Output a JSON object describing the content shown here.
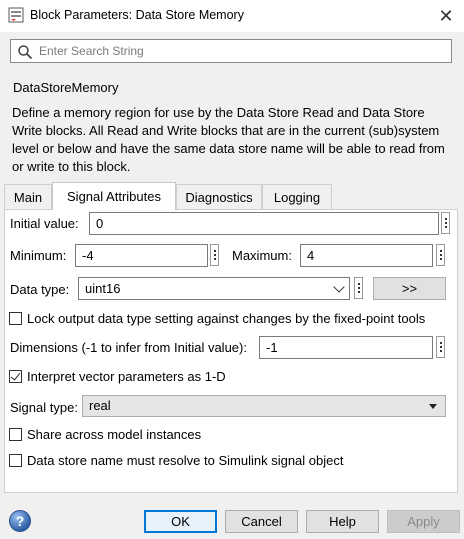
{
  "window": {
    "title": "Block Parameters: Data Store Memory",
    "close_glyph": "✕"
  },
  "search": {
    "placeholder": "Enter Search String",
    "value": ""
  },
  "block": {
    "name": "DataStoreMemory",
    "description": "Define a memory region for use by the Data Store Read and Data Store Write blocks. All Read and Write blocks that are in the current (sub)system level or below and have the same data store name will be able to read from or write to this block."
  },
  "tabs": [
    {
      "label": "Main",
      "active": false
    },
    {
      "label": "Signal Attributes",
      "active": true
    },
    {
      "label": "Diagnostics",
      "active": false
    },
    {
      "label": "Logging",
      "active": false
    }
  ],
  "form": {
    "initial_value": {
      "label": "Initial value:",
      "value": "0"
    },
    "minimum": {
      "label": "Minimum:",
      "value": "-4"
    },
    "maximum": {
      "label": "Maximum:",
      "value": "4"
    },
    "data_type": {
      "label": "Data type:",
      "value": "uint16",
      "assistant_label": ">>"
    },
    "lock_output": {
      "label": "Lock output data type setting against changes by the fixed-point tools",
      "checked": false
    },
    "dimensions": {
      "label": "Dimensions (-1 to infer from Initial value):",
      "value": "-1"
    },
    "interpret_vector": {
      "label": "Interpret vector parameters as 1-D",
      "checked": true
    },
    "signal_type": {
      "label": "Signal type:",
      "value": "real"
    },
    "share_instances": {
      "label": "Share across model instances",
      "checked": false
    },
    "resolve_signal": {
      "label": "Data store name must resolve to Simulink signal object",
      "checked": false
    }
  },
  "buttons": {
    "help_glyph": "?",
    "ok": "OK",
    "cancel": "Cancel",
    "help": "Help",
    "apply": "Apply"
  },
  "colors": {
    "accent": "#0078d7",
    "panel_bg": "#ffffff",
    "window_bg": "#f0f0f0"
  }
}
